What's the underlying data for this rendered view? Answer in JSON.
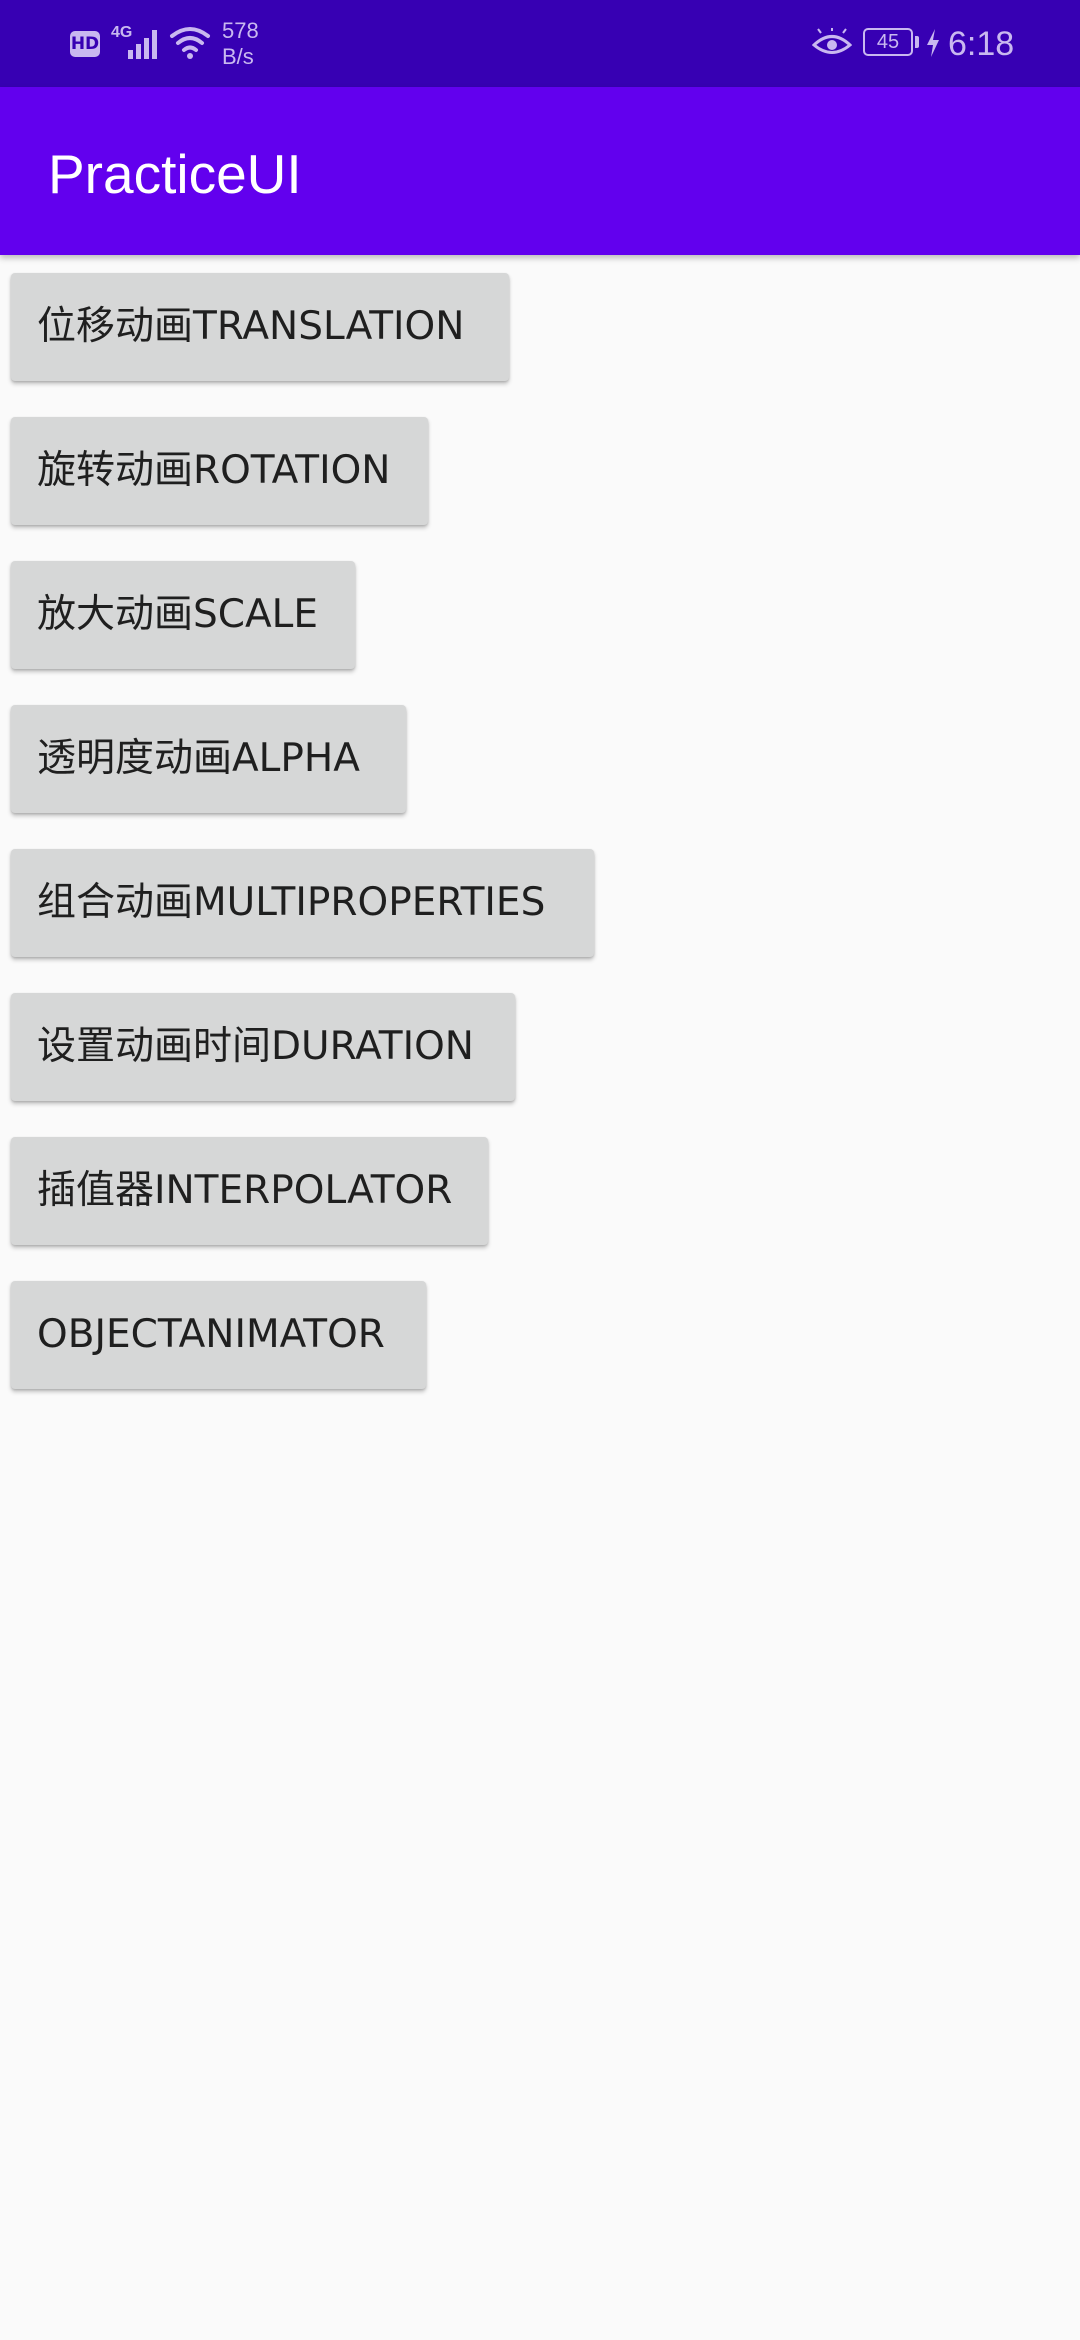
{
  "status_bar": {
    "hd_label": "HD",
    "network_type": "4G",
    "speed_value": "578",
    "speed_unit": "B/s",
    "battery_level": "45",
    "time": "6:18",
    "icons": [
      "signal-icon",
      "wifi-icon",
      "eye-icon",
      "battery-icon",
      "charging-icon"
    ]
  },
  "app_bar": {
    "title": "PracticeUI",
    "color": "#6200ee"
  },
  "buttons": [
    "位移动画TRANSLATION",
    "旋转动画ROTATION",
    "放大动画SCALE",
    "透明度动画ALPHA",
    "组合动画MULTIPROPERTIES",
    "设置动画时间DURATION",
    "插值器INTERPOLATOR",
    "OBJECTANIMATOR"
  ],
  "colors": {
    "status_bar": "#3700b3",
    "app_bar": "#6200ee",
    "button_background": "#d6d7d7",
    "page_background": "#fafafa"
  }
}
